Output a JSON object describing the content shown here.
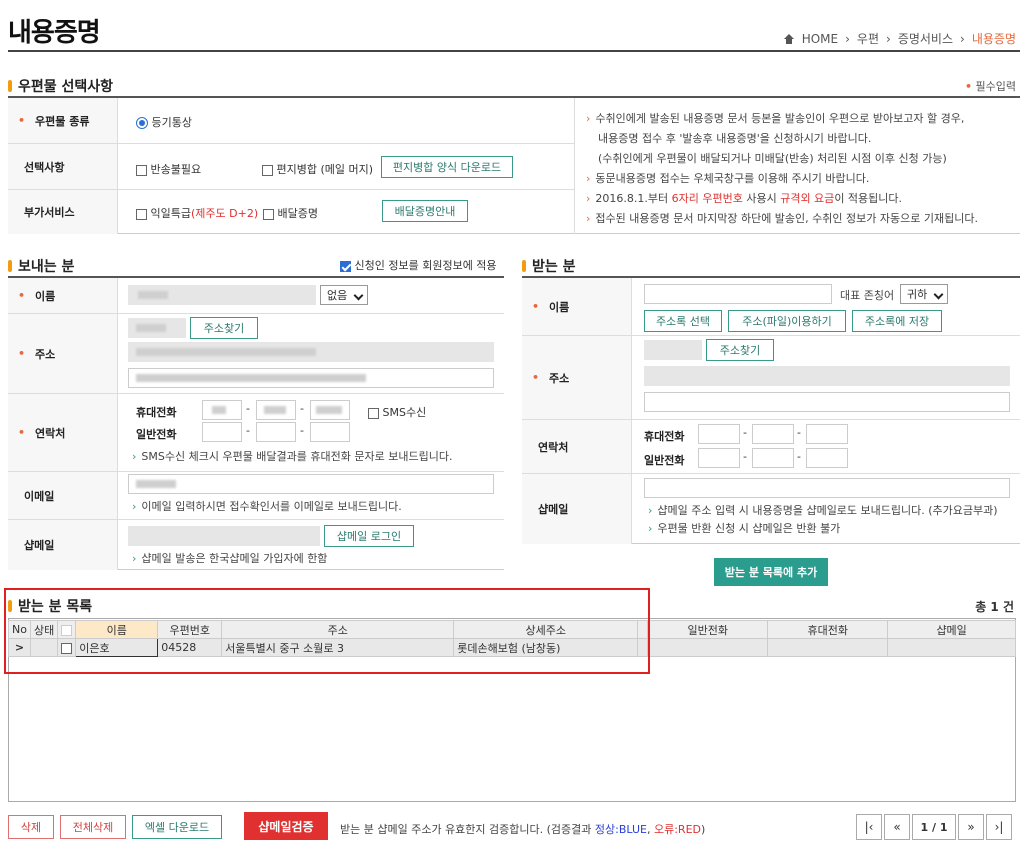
{
  "header": {
    "title": "내용증명",
    "breadcrumb": [
      "HOME",
      "우편",
      "증명서비스",
      "내용증명"
    ],
    "required": "필수입력",
    "required_mark": "•"
  },
  "mail_section": {
    "title": "우편물 선택사항",
    "rows": [
      {
        "label": "우편물 종류",
        "required": true,
        "options": [
          "등기통상"
        ]
      },
      {
        "label": "선택사항",
        "options": [
          "반송불필요",
          "편지병합 (메일 머지)"
        ],
        "button": "편지병합 양식 다운로드"
      },
      {
        "label": "부가서비스",
        "options": [
          "익일특급",
          "배달증명"
        ],
        "note_red": "(제주도 D+2)",
        "button": "배달증명안내"
      }
    ],
    "info": [
      "수취인에게 발송된 내용증명 문서 등본을 발송인이 우편으로 받아보고자 할 경우,",
      "내용증명 접수 후 '발송후 내용증명'을 신청하시기 바랍니다.",
      "(수취인에게 우편물이 배달되거나 미배달(반송) 처리된 시점 이후 신청 가능)",
      "동문내용증명 접수는 우체국창구를 이용해 주시기 바랍니다.",
      "2016.8.1.부터 ",
      "6자리 우편번호",
      " 사용시 ",
      "규격외 요금",
      "이 적용됩니다.",
      "접수된 내용증명 문서 마지막장 하단에 발송인, 수취인 정보가 자동으로 기재됩니다."
    ]
  },
  "sender": {
    "title": "보내는 분",
    "sync_label": "신청인 정보를 회원정보에 적용",
    "name_label": "이름",
    "suffix_select": "없음",
    "address_label": "주소",
    "address_button": "주소찾기",
    "contact_label": "연락처",
    "mobile_label": "휴대전화",
    "phone_label": "일반전화",
    "sms_label": "SMS수신",
    "sms_note": "SMS수신 체크시 우편물 배달결과를 휴대전화 문자로 보내드립니다.",
    "email_label": "이메일",
    "email_note": "이메일 입력하시면 접수확인서를 이메일로 보내드립니다.",
    "shopmail_label": "샵메일",
    "shopmail_button": "샵메일 로그인",
    "shopmail_note": "샵메일 발송은 한국샵메일 가입자에 한함"
  },
  "receiver": {
    "title": "받는 분",
    "name_label": "이름",
    "honorific_label": "대표 존칭어",
    "honorific": "귀하",
    "btn_select": "주소록 선택",
    "btn_file": "주소(파일)이용하기",
    "btn_save": "주소록에 저장",
    "address_label": "주소",
    "address_button": "주소찾기",
    "contact_label": "연락처",
    "mobile_label": "휴대전화",
    "phone_label": "일반전화",
    "shopmail_label": "샵메일",
    "shopmail_notes": [
      "샵메일 주소 입력 시 내용증명을 샵메일로도 보내드립니다. (추가요금부과)",
      "우편물 반환 신청 시 샵메일은 반환 불가"
    ],
    "add_button": "받는 분 목록에 추가"
  },
  "list": {
    "title": "받는 분 목록",
    "total": "총 1 건",
    "columns": [
      "No",
      "상태",
      "",
      "이름",
      "우편번호",
      "주소",
      "상세주소",
      "",
      "일반전화",
      "휴대전화",
      "샵메일"
    ],
    "rows": [
      {
        "no": ">",
        "name": "이은호",
        "zip": "04528",
        "address": "서울특별시 중구 소월로 3",
        "detail": "롯데손해보험 (남창동)"
      }
    ]
  },
  "footer": {
    "delete": "삭제",
    "delete_all": "전체삭제",
    "excel": "엑셀 다운로드",
    "verify": "샵메일검증",
    "verify_note": "받는 분 샵메일 주소가 유효한지 검증합니다. (검증결과 ",
    "ok": "정상:BLUE",
    "sep": ", ",
    "err": "오류:RED",
    "close": ")",
    "page": "1 / 1"
  },
  "colors": {
    "accent": "#e8673b",
    "teal": "#2a9d8f",
    "verify": "#e03030"
  }
}
